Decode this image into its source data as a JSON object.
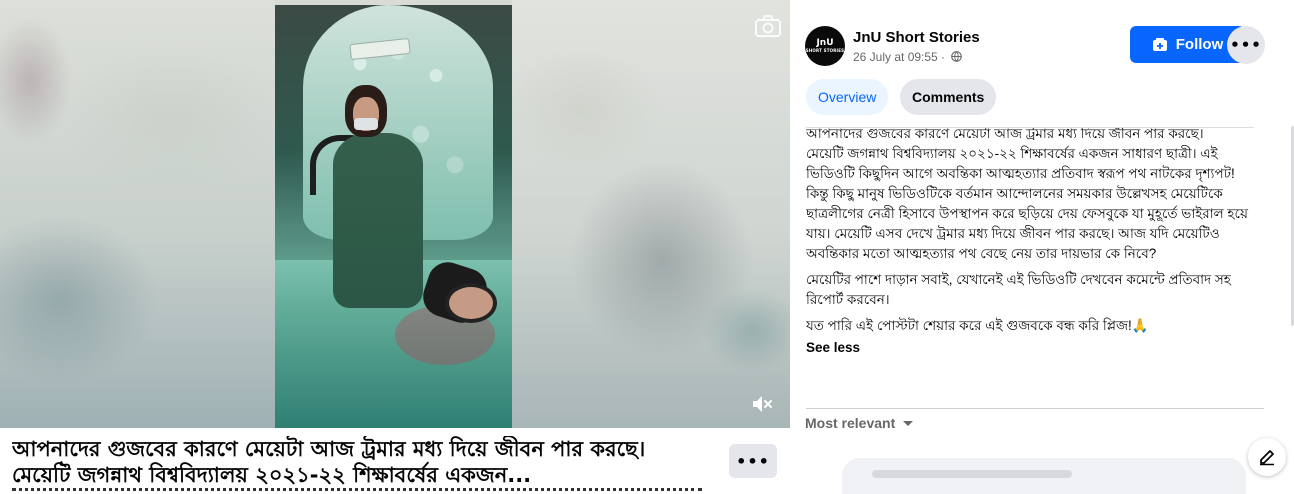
{
  "video": {
    "camera_icon": "camera-icon",
    "sound_icon": "speaker-muted-icon"
  },
  "caption": {
    "text": "আপনাদের গুজবের কারণে মেয়েটা আজ ট্রমার মধ্য দিয়ে জীবন পার করছে। মেয়েটি জগন্নাথ বিশ্ববিদ্যালয় ২০২১-২২ শিক্ষাবর্ষের একজন...",
    "more_icon": "•••"
  },
  "post": {
    "page_name": "JnU Short Stories",
    "avatar_text": "JnU",
    "avatar_sub": "SHORT STORIES",
    "timestamp": "26 July at 09:55 ·",
    "follow_label": "Follow",
    "more_icon": "•••"
  },
  "tabs": {
    "overview": "Overview",
    "comments": "Comments"
  },
  "description": {
    "para1": "আপনাদের গুজবের কারণে মেয়েটা আজ ট্রমার মধ্য দিয়ে জীবন পার করছে।\nমেয়েটি জগন্নাথ বিশ্ববিদ্যালয় ২০২১-২২ শিক্ষাবর্ষের একজন সাধারণ ছাত্রী। এই ভিডিওটি কিছুদিন আগে অবন্তিকা আত্মহত্যার প্রতিবাদ স্বরূপ পথ নাটকের দৃশ্যপট! কিন্তু কিছু মানুষ ভিডিওটিকে বর্তমান আন্দোলনের সময়কার উল্লেখসহ মেয়েটিকে ছাত্রলীগের নেত্রী হিসাবে উপস্থাপন করে ছড়িয়ে দেয় ফেসবুকে যা মুহূর্তে ভাইরাল হয়ে যায়। মেয়েটি এসব দেখে ট্রমার মধ্য দিয়ে জীবন পার করছে। আজ যদি মেয়েটিও অবন্তিকার মতো আত্মহত্যার পথ বেছে নেয় তার দায়ভার কে নিবে?",
    "para2": "মেয়েটির পাশে দাড়ান সবাই, যেখানেই এই ভিডিওটি দেখবেন কমেন্টে প্রতিবাদ সহ রিপোর্ট করবেন।",
    "para3": "যত পারি এই পোস্টটা শেয়ার করে এই গুজবকে বন্ধ করি প্লিজ!🙏",
    "see_less": "See less"
  },
  "comments": {
    "sort_label": "Most relevant"
  },
  "colors": {
    "accent": "#0866ff",
    "secondary_bg": "#e4e6eb",
    "muted_text": "#65676b"
  }
}
